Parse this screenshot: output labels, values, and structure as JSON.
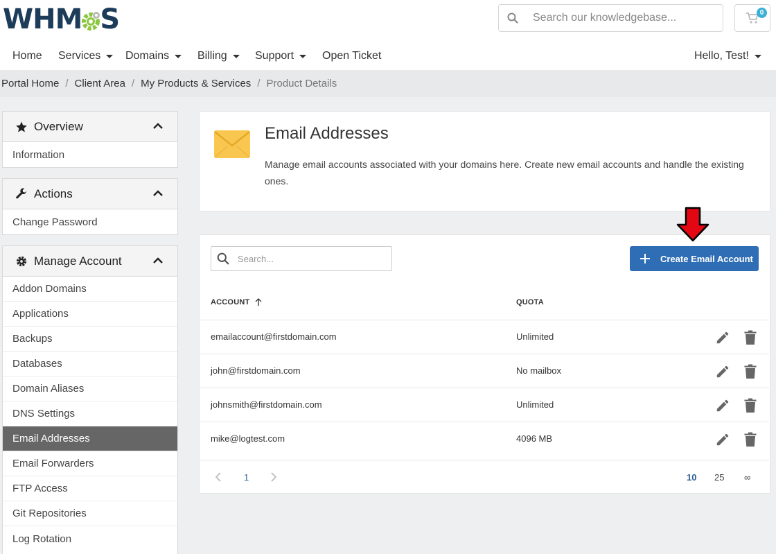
{
  "header": {
    "logo_text_left": "WHM",
    "logo_text_right": "S",
    "search_placeholder": "Search our knowledgebase...",
    "cart_count": "0",
    "nav": [
      {
        "label": "Home",
        "dropdown": false
      },
      {
        "label": "Services",
        "dropdown": true
      },
      {
        "label": "Domains",
        "dropdown": true
      },
      {
        "label": "Billing",
        "dropdown": true
      },
      {
        "label": "Support",
        "dropdown": true
      },
      {
        "label": "Open Ticket",
        "dropdown": false
      }
    ],
    "user_menu": "Hello, Test!"
  },
  "breadcrumb": [
    "Portal Home",
    "Client Area",
    "My Products & Services",
    "Product Details"
  ],
  "sidebar": {
    "overview": {
      "title": "Overview",
      "items": [
        "Information"
      ]
    },
    "actions": {
      "title": "Actions",
      "items": [
        "Change Password"
      ]
    },
    "manage": {
      "title": "Manage Account",
      "items": [
        "Addon Domains",
        "Applications",
        "Backups",
        "Databases",
        "Domain Aliases",
        "DNS Settings",
        "Email Addresses",
        "Email Forwarders",
        "FTP Access",
        "Git Repositories",
        "Log Rotation"
      ],
      "active": "Email Addresses"
    }
  },
  "intro": {
    "title": "Email Addresses",
    "description": "Manage email accounts associated with your domains here. Create new email accounts and handle the existing ones."
  },
  "table": {
    "search_placeholder": "Search...",
    "create_button": "Create Email Account",
    "columns": {
      "account": "ACCOUNT",
      "quota": "QUOTA"
    },
    "rows": [
      {
        "account": "emailaccount@firstdomain.com",
        "quota": "Unlimited"
      },
      {
        "account": "john@firstdomain.com",
        "quota": "No mailbox"
      },
      {
        "account": "johnsmith@firstdomain.com",
        "quota": "Unlimited"
      },
      {
        "account": "mike@logtest.com",
        "quota": "4096 MB"
      }
    ],
    "pagination": {
      "current_page": "1",
      "page_sizes": [
        "10",
        "25",
        "∞"
      ],
      "selected_size": "10"
    }
  },
  "colors": {
    "primary": "#2f6eb5",
    "logo_navy": "#1d3c5a",
    "logo_green": "#8cc63f",
    "active_item": "#666666",
    "arrow_red": "#e30613",
    "envelope": "#f9c74f"
  }
}
